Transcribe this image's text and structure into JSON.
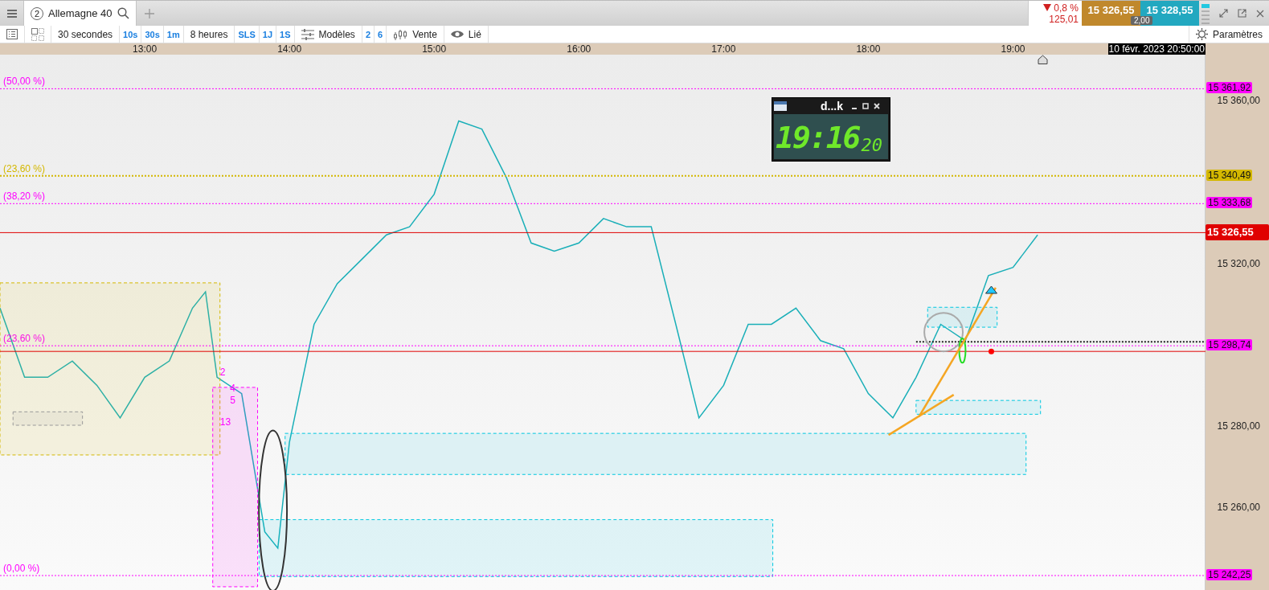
{
  "tab_bar": {
    "tabs": [
      {
        "number": "2",
        "label": "Allemagne 40",
        "selected": true
      }
    ],
    "change": {
      "negative": true,
      "percent": "0,8 %",
      "points": "125,01"
    },
    "sell_price": "15 326,55",
    "buy_price": "15 328,55",
    "spread": "2,00"
  },
  "toolbar": {
    "items": [
      {
        "kind": "label",
        "text": "30 secondes"
      },
      {
        "kind": "quick",
        "text": "10s"
      },
      {
        "kind": "quick",
        "text": "30s"
      },
      {
        "kind": "quick",
        "text": "1m"
      },
      {
        "kind": "label",
        "text": "8 heures"
      },
      {
        "kind": "quick",
        "text": "SLS"
      },
      {
        "kind": "quick",
        "text": "1J"
      },
      {
        "kind": "quick",
        "text": "1S"
      },
      {
        "kind": "templates",
        "text": "Modèles"
      },
      {
        "kind": "quick",
        "text": "2"
      },
      {
        "kind": "quick",
        "text": "6"
      },
      {
        "kind": "chart-style",
        "text": "Vente"
      },
      {
        "kind": "link",
        "text": "Lié"
      }
    ],
    "settings_label": "Paramètres"
  },
  "chart": {
    "cursor_time": "10 févr. 2023 20:50:00",
    "clock_widget": {
      "title": "d...k",
      "time": "19:16",
      "seconds": "20"
    },
    "levels": [
      {
        "kind": "fibonacci",
        "label": "(50,00 %)",
        "price": "15 361,92",
        "color": "#ff00ff"
      },
      {
        "kind": "fibonacci",
        "label": "(23,60 %)",
        "price": "15 340,49",
        "color": "#d4b800"
      },
      {
        "kind": "fibonacci",
        "label": "(38,20 %)",
        "price": "15 333,68",
        "color": "#ff00ff"
      },
      {
        "kind": "current-price",
        "price": "15 326,55",
        "color": "#e00000"
      },
      {
        "kind": "fibonacci",
        "label": "(23,60 %)",
        "price": "15 298,74",
        "color": "#ff00ff"
      },
      {
        "kind": "fibonacci",
        "label": "(0,00 %)",
        "price": "15 242,25",
        "color": "#ff00ff"
      }
    ],
    "wave_labels": [
      "2",
      "4",
      "5",
      "13"
    ],
    "chart_data": {
      "type": "line",
      "xlim": [
        12,
        20.33
      ],
      "ylim": [
        15238.5,
        15370.3
      ],
      "xticks": [
        {
          "value": 13,
          "label": "13:00"
        },
        {
          "value": 14,
          "label": "14:00"
        },
        {
          "value": 15,
          "label": "15:00"
        },
        {
          "value": 16,
          "label": "16:00"
        },
        {
          "value": 17,
          "label": "17:00"
        },
        {
          "value": 18,
          "label": "18:00"
        },
        {
          "value": 19,
          "label": "19:00"
        }
      ],
      "yticks": [
        {
          "value": 15360,
          "label": "15 360,00"
        },
        {
          "value": 15320,
          "label": "15 320,00"
        },
        {
          "value": 15280,
          "label": "15 280,00"
        },
        {
          "value": 15260,
          "label": "15 260,00"
        }
      ],
      "x": [
        12,
        12.17,
        12.33,
        12.5,
        12.67,
        12.83,
        13,
        13.17,
        13.33,
        13.42,
        13.5,
        13.67,
        13.83,
        13.92,
        14,
        14.17,
        14.33,
        14.5,
        14.67,
        14.83,
        15,
        15.17,
        15.33,
        15.5,
        15.67,
        15.83,
        16,
        16.17,
        16.33,
        16.5,
        16.67,
        16.83,
        17,
        17.17,
        17.33,
        17.5,
        17.67,
        17.83,
        18,
        18.17,
        18.33,
        18.5,
        18.67,
        18.83,
        19,
        19.17
      ],
      "series": [
        {
          "color": "#1aafb8",
          "values": [
            15308,
            15291,
            15291,
            15295,
            15289,
            15281,
            15291,
            15295,
            15308,
            15312,
            15291,
            15287,
            15253,
            15249,
            15275,
            15304,
            15314,
            15320,
            15326,
            15328,
            15336,
            15354,
            15352,
            15340,
            15324,
            15322,
            15324,
            15330,
            15328,
            15328,
            15304,
            15281,
            15289,
            15304,
            15304,
            15308,
            15300,
            15298,
            15287,
            15281,
            15291,
            15304,
            15300,
            15316,
            15318,
            15326
          ]
        }
      ]
    }
  }
}
